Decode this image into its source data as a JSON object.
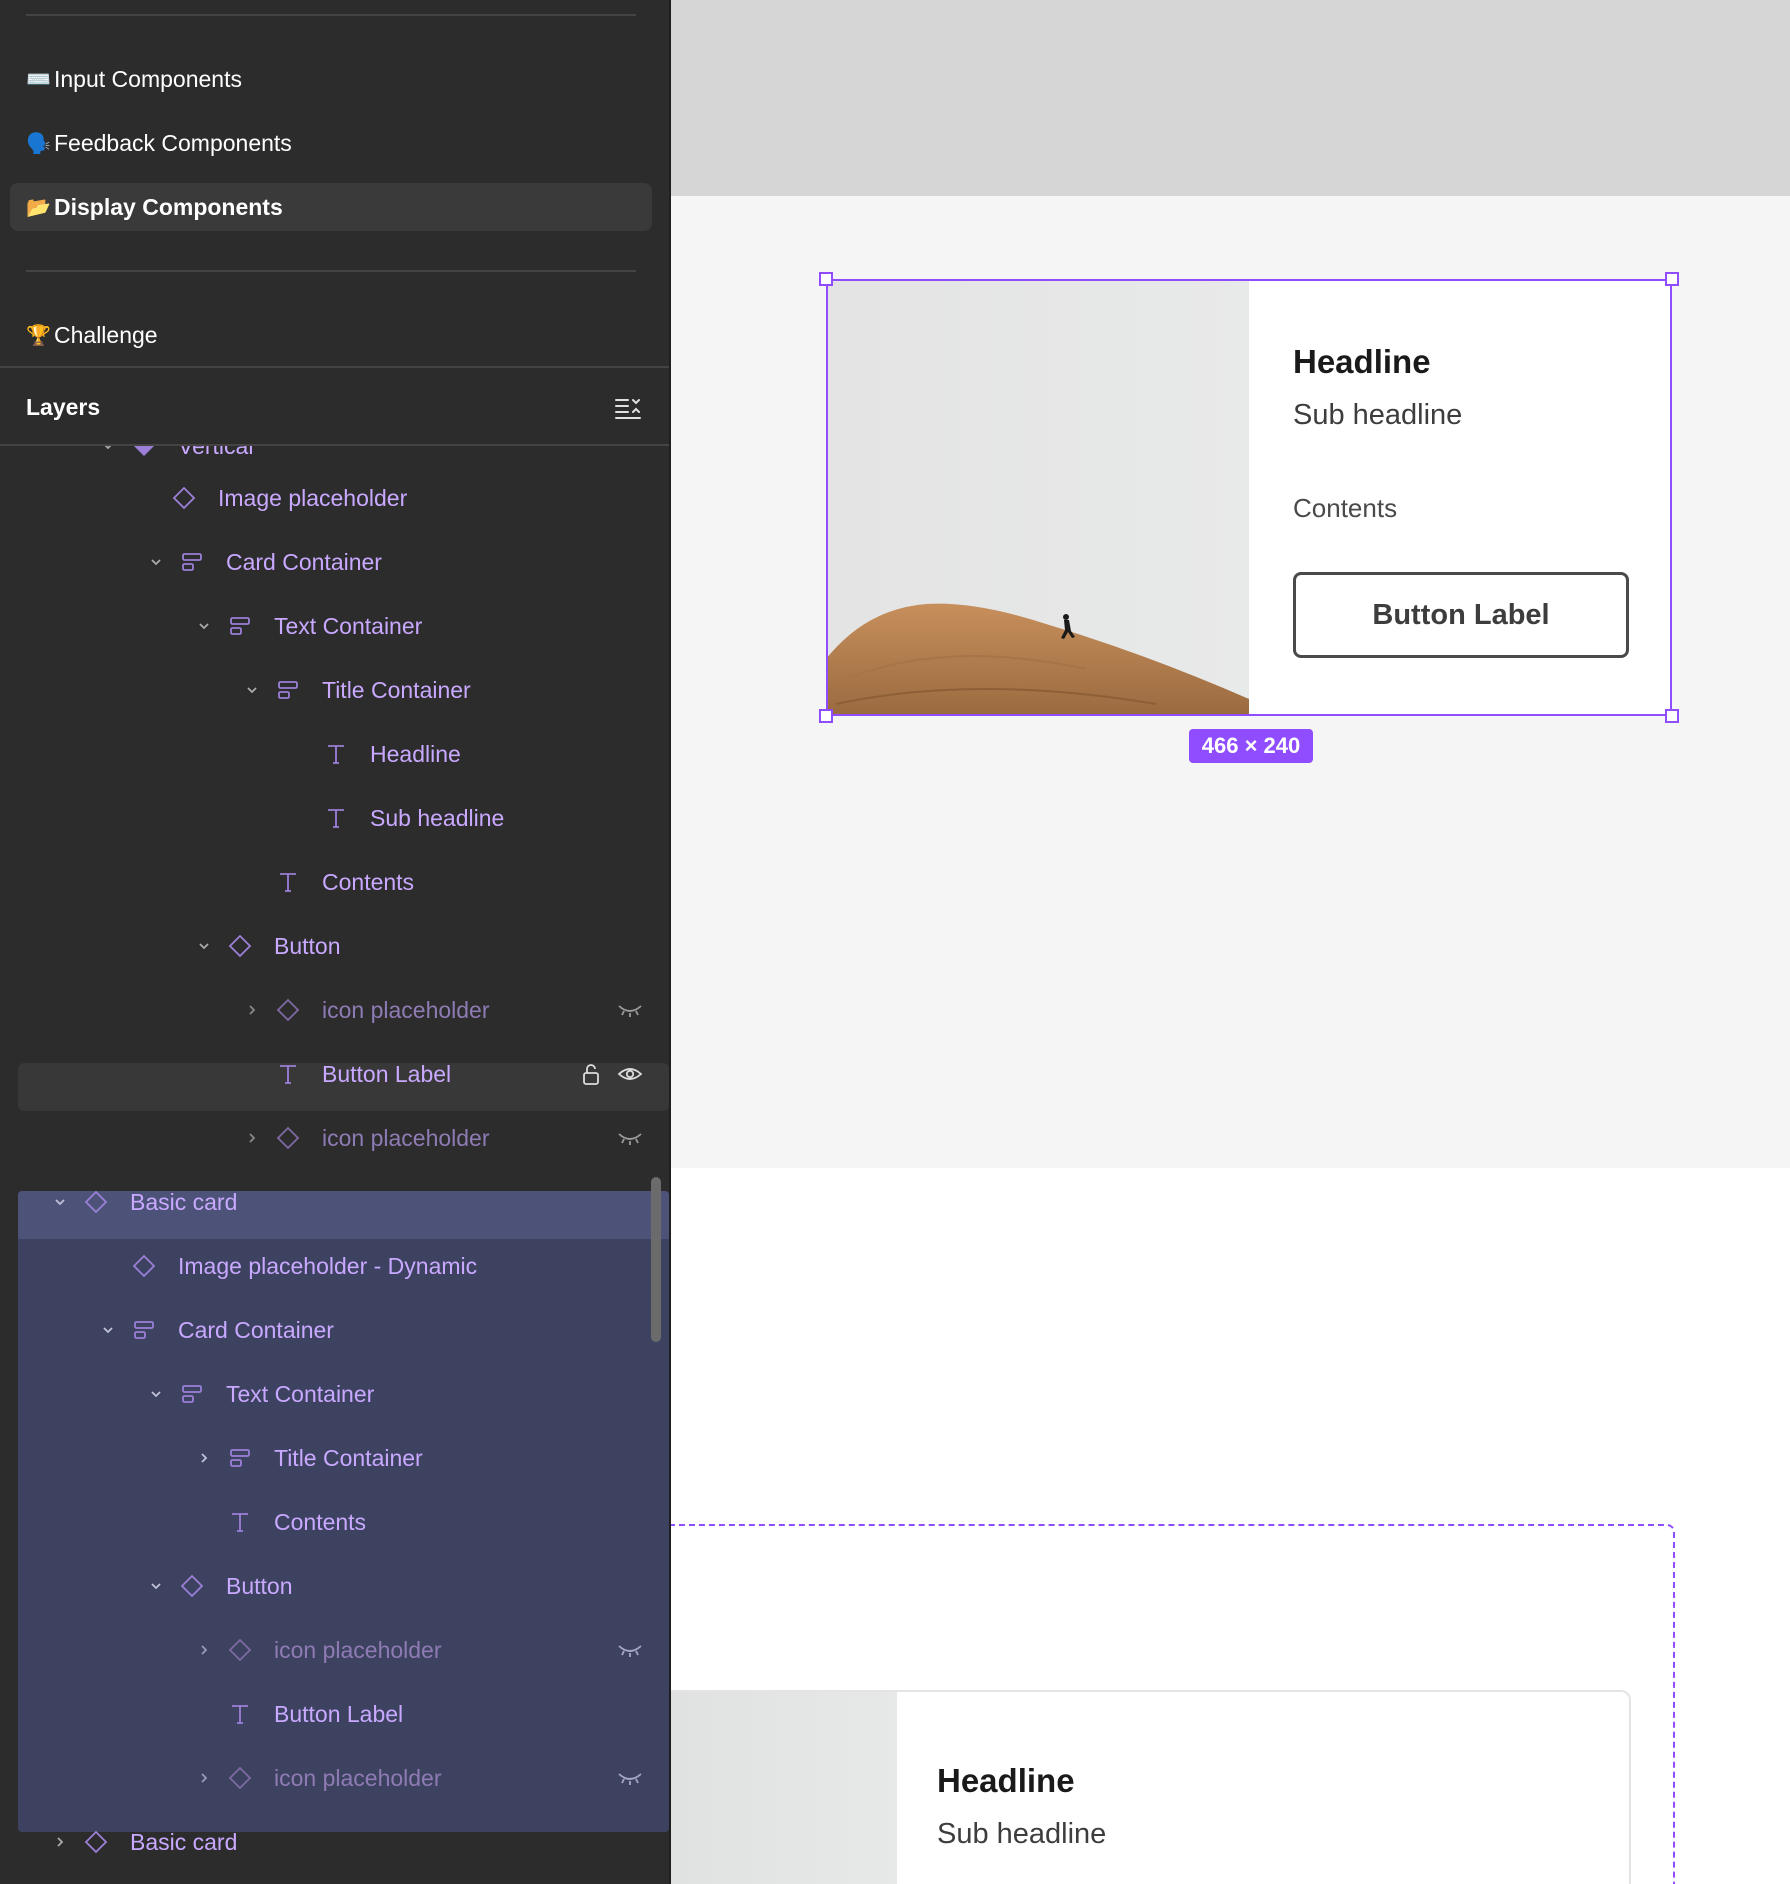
{
  "pages": [
    {
      "emoji": "⌨️",
      "label": "Input Components",
      "active": false
    },
    {
      "emoji": "🗣️",
      "label": "Feedback Components",
      "active": false
    },
    {
      "emoji": "📂",
      "label": "Display Components",
      "active": true
    },
    {
      "emoji": "🏆",
      "label": "Challenge",
      "active": false
    }
  ],
  "layers_panel": {
    "title": "Layers",
    "rows": [
      {
        "label": "Vertical",
        "icon": "component-instance-icon",
        "expanded": true
      },
      {
        "label": "Image placeholder",
        "icon": "component-icon"
      },
      {
        "label": "Card Container",
        "icon": "auto-layout-icon",
        "expanded": true
      },
      {
        "label": "Text Container",
        "icon": "auto-layout-icon",
        "expanded": true
      },
      {
        "label": "Title Container",
        "icon": "auto-layout-icon",
        "expanded": true
      },
      {
        "label": "Headline",
        "icon": "text-icon"
      },
      {
        "label": "Sub headline",
        "icon": "text-icon"
      },
      {
        "label": "Contents",
        "icon": "text-icon"
      },
      {
        "label": "Button",
        "icon": "component-icon",
        "expanded": true
      },
      {
        "label": "icon placeholder",
        "icon": "component-icon",
        "hidden": true
      },
      {
        "label": "Button Label",
        "icon": "text-icon",
        "hovered": true
      },
      {
        "label": "icon placeholder",
        "icon": "component-icon",
        "hidden": true
      },
      {
        "label": "Basic card",
        "icon": "component-icon",
        "expanded": true,
        "selected": true
      },
      {
        "label": "Image placeholder - Dynamic",
        "icon": "component-icon"
      },
      {
        "label": "Card Container",
        "icon": "auto-layout-icon",
        "expanded": true
      },
      {
        "label": "Text Container",
        "icon": "auto-layout-icon",
        "expanded": true
      },
      {
        "label": "Title Container",
        "icon": "auto-layout-icon",
        "expanded": false
      },
      {
        "label": "Contents",
        "icon": "text-icon"
      },
      {
        "label": "Button",
        "icon": "component-icon",
        "expanded": true
      },
      {
        "label": "icon placeholder",
        "icon": "component-icon",
        "hidden": true
      },
      {
        "label": "Button Label",
        "icon": "text-icon"
      },
      {
        "label": "icon placeholder",
        "icon": "component-icon",
        "hidden": true
      },
      {
        "label": "Basic card",
        "icon": "component-icon",
        "expanded": false
      }
    ]
  },
  "canvas": {
    "card1": {
      "headline": "Headline",
      "subheadline": "Sub headline",
      "contents": "Contents",
      "button_label": "Button Label"
    },
    "selection_size": "466 × 240",
    "card2": {
      "headline": "Headline",
      "subheadline": "Sub headline"
    }
  },
  "colors": {
    "accent": "#8f4dff",
    "layer_text": "#c9a9ff",
    "selection_bg": "#3d4260",
    "sidebar_bg": "#2c2c2c",
    "canvas_top": "#d6d6d6",
    "canvas_section": "#f5f5f5"
  }
}
